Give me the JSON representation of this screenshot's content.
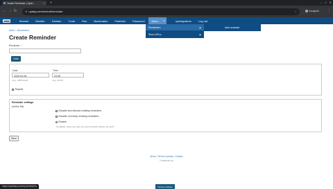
{
  "browser": {
    "tab_title": "Create Reminder | Upsi...",
    "url": "upday.com/en/edit/reminder",
    "profile": "Incognito"
  },
  "navbar": {
    "brand": "BRAND",
    "links": [
      "Browse",
      "Monitor",
      "Kanban",
      "Code",
      "Run",
      "Bookmarks",
      "Pastebin",
      "Password",
      "More..."
    ],
    "username": "upsdaydame",
    "logout": "Log out"
  },
  "dropdown": {
    "items": [
      "Reminders",
      "Short URLs"
    ],
    "submenu_item": "Add reminder"
  },
  "page": {
    "breadcrumb": [
      "Main",
      "Reminders"
    ],
    "breadcrumb_sep": "»",
    "title": "Create Reminder"
  },
  "form": {
    "reminder_label": "Reminder",
    "required_mark": "*",
    "reminder_value": "",
    "date_button": "Date",
    "date_label": "Date",
    "date_value": "2025-04-26",
    "date_help": "E.g., 2025-04-26",
    "time_label": "Time",
    "time_value": "23:45",
    "time_help": "E.g., 23:45",
    "repeat_label": "Repeat",
    "settings_title": "Reminder settings",
    "settings_subtitle": "(online list)",
    "options": [
      "Disable and discard existing reminders",
      "Disable, but keep existing reminders",
      "Enable"
    ],
    "selected_option": "Enable",
    "options_help": "If enabled, users can sign up to get reminders before the event",
    "save_label": "Save"
  },
  "footer": {
    "links": [
      "About",
      "Terms & privacy",
      "Contact"
    ],
    "sep": "|",
    "copyright": "© 2025 link.me"
  },
  "status": {
    "hover_url": "https://updday.com/my/reminders",
    "privacy_button": "Privacy settings"
  }
}
